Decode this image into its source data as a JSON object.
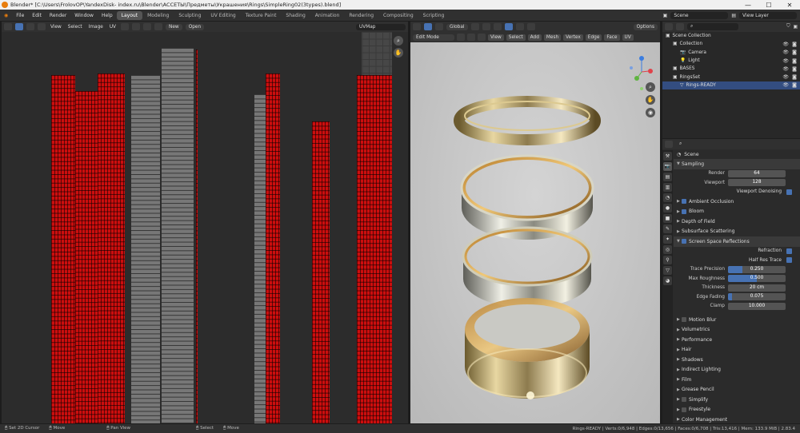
{
  "window": {
    "title": "Blender* [C:\\Users\\FrolovOP\\YandexDisk-                                   index.ru\\Blender\\АССЕТЫ\\Предметы\\Украшения\\Rings\\SimpleRing02(3types).blend]",
    "controls": [
      "—",
      "☐",
      "✕"
    ]
  },
  "menu": {
    "items": [
      "File",
      "Edit",
      "Render",
      "Window",
      "Help"
    ],
    "workspaces": [
      "Layout",
      "Modeling",
      "Sculpting",
      "UV Editing",
      "Texture Paint",
      "Shading",
      "Animation",
      "Rendering",
      "Compositing",
      "Scripting"
    ],
    "active_workspace": "Layout",
    "scene": "Scene",
    "view_layer": "View Layer"
  },
  "uv_editor": {
    "menus": [
      "View",
      "Select",
      "Image",
      "UV"
    ],
    "new_label": "New",
    "open_label": "Open",
    "uvmap_name": "UVMap"
  },
  "viewport": {
    "mode": "Edit Mode",
    "menus": [
      "View",
      "Select",
      "Add",
      "Mesh",
      "Vertex",
      "Edge",
      "Face",
      "UV"
    ],
    "orientation": "Global",
    "options_label": "Options"
  },
  "outliner": {
    "search_placeholder": "",
    "rows": [
      {
        "label": "Scene Collection",
        "indent": 0
      },
      {
        "label": "Collection",
        "indent": 1
      },
      {
        "label": "Camera",
        "indent": 2
      },
      {
        "label": "Light",
        "indent": 2
      },
      {
        "label": "BASES",
        "indent": 1
      },
      {
        "label": "RingsSet",
        "indent": 1
      },
      {
        "label": "Rings-READY",
        "indent": 2
      }
    ]
  },
  "properties": {
    "context": "Scene",
    "sampling": {
      "title": "Sampling",
      "render_label": "Render",
      "render_value": "64",
      "viewport_label": "Viewport",
      "viewport_value": "128",
      "denoise_label": "Viewport Denoising"
    },
    "sections_top": [
      {
        "label": "Ambient Occlusion",
        "checkbox": true
      },
      {
        "label": "Bloom",
        "checkbox": true
      },
      {
        "label": "Depth of Field",
        "checkbox": null
      },
      {
        "label": "Subsurface Scattering",
        "checkbox": null
      },
      {
        "label": "Screen Space Reflections",
        "checkbox": true
      }
    ],
    "ssr": {
      "refraction_label": "Refraction",
      "half_res_label": "Half Res Trace",
      "fields": [
        {
          "label": "Trace Precision",
          "value": "0.250",
          "fill": 0.25
        },
        {
          "label": "Max Roughness",
          "value": "0.500",
          "fill": 0.5
        },
        {
          "label": "Thickness",
          "value": "20 cm",
          "fill": 0
        },
        {
          "label": "Edge Fading",
          "value": "0.075",
          "fill": 0.075
        },
        {
          "label": "Clamp",
          "value": "10.000",
          "fill": 0
        }
      ]
    },
    "sections_bottom": [
      {
        "label": "Motion Blur",
        "checkbox": false
      },
      {
        "label": "Volumetrics",
        "checkbox": null
      },
      {
        "label": "Performance",
        "checkbox": null
      },
      {
        "label": "Hair",
        "checkbox": null
      },
      {
        "label": "Shadows",
        "checkbox": null
      },
      {
        "label": "Indirect Lighting",
        "checkbox": null
      },
      {
        "label": "Film",
        "checkbox": null
      },
      {
        "label": "Grease Pencil",
        "checkbox": null
      },
      {
        "label": "Simplify",
        "checkbox": false
      },
      {
        "label": "Freestyle",
        "checkbox": false
      },
      {
        "label": "Color Management",
        "checkbox": null
      }
    ]
  },
  "statusbar": {
    "left": [
      "Set 2D Cursor",
      "Move",
      "Pan View",
      "Select",
      "Move"
    ],
    "stats": "Rings-READY | Verts:0/6,948 | Edges:0/13,656 | Faces:0/6,708 | Tris:13,416 | Mem: 133.9 MiB | 2.83.4"
  }
}
